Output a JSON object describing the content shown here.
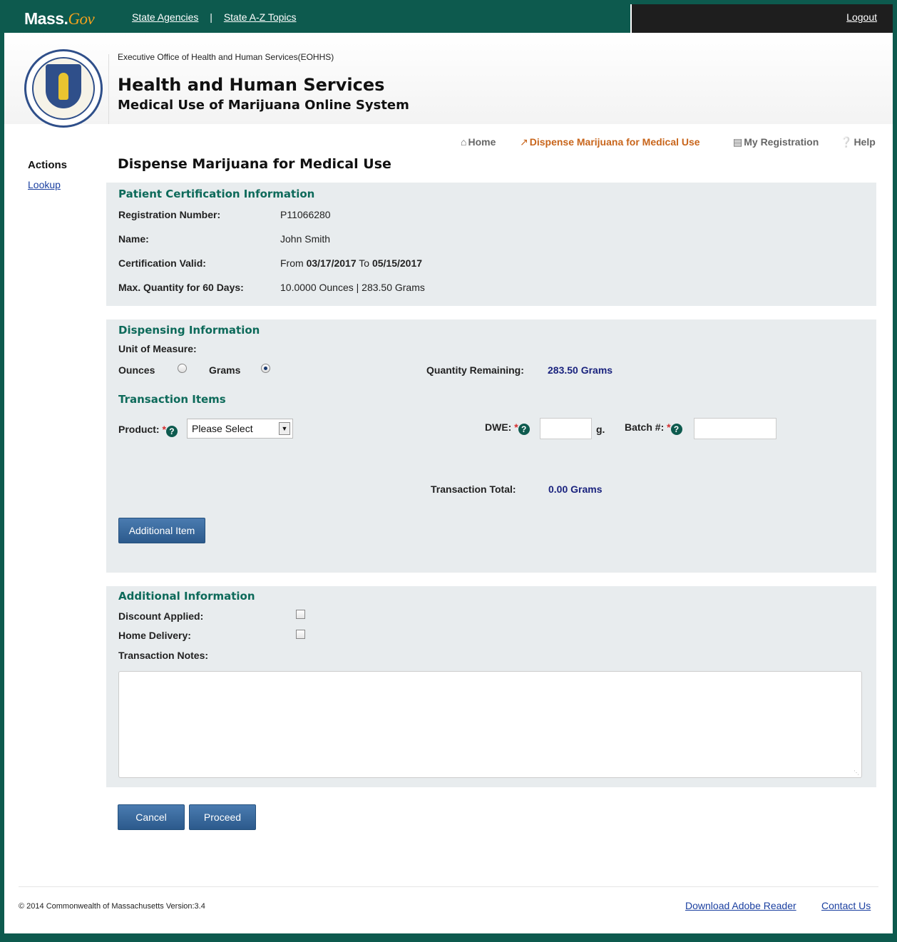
{
  "topbar": {
    "logo_mass": "Mass.",
    "logo_gov": "Gov",
    "links": [
      "State Agencies",
      "State A-Z Topics"
    ],
    "separator": "|",
    "logout": "Logout"
  },
  "header": {
    "agency": "Executive Office of Health and Human Services(EOHHS)",
    "title": "Health and Human Services",
    "subtitle": "Medical Use of Marijuana Online System"
  },
  "nav": {
    "home": "Home",
    "dispense": "Dispense Marijuana for Medical Use",
    "registration": "My Registration",
    "help": "Help"
  },
  "sidebar": {
    "title": "Actions",
    "lookup": "Lookup"
  },
  "page_title": "Dispense Marijuana for Medical Use",
  "patient": {
    "section_title": "Patient Certification Information",
    "reg_label": "Registration Number:",
    "reg_value": "P11066280",
    "name_label": "Name:",
    "name_value": "John Smith",
    "cert_label": "Certification Valid:",
    "cert_from_word": "From",
    "cert_from": "03/17/2017",
    "cert_to_word": "To",
    "cert_to": "05/15/2017",
    "max_label": "Max. Quantity for 60 Days:",
    "max_value": "10.0000 Ounces | 283.50 Grams"
  },
  "dispensing": {
    "section_title": "Dispensing Information",
    "uom_label": "Unit of Measure:",
    "ounces": "Ounces",
    "grams": "Grams",
    "selected_unit": "Grams",
    "qty_remaining_label": "Quantity Remaining:",
    "qty_remaining_value": "283.50 Grams",
    "transaction_items_title": "Transaction Items",
    "product_label": "Product:",
    "product_selected": "Please Select",
    "dwe_label": "DWE:",
    "dwe_unit": "g.",
    "batch_label": "Batch #:",
    "total_label": "Transaction Total:",
    "total_value": "0.00 Grams",
    "additional_item_button": "Additional Item"
  },
  "additional": {
    "section_title": "Additional Information",
    "discount_label": "Discount Applied:",
    "delivery_label": "Home Delivery:",
    "notes_label": "Transaction Notes:"
  },
  "buttons": {
    "cancel": "Cancel",
    "proceed": "Proceed"
  },
  "footer": {
    "copyright": "© 2014 Commonwealth of Massachusetts Version:3.4",
    "adobe": "Download Adobe Reader",
    "contact": "Contact Us"
  },
  "colors": {
    "brand_green": "#0d5a4e",
    "section_title": "#0d6a5a",
    "active_nav": "#c8651b",
    "value_blue": "#1a237e",
    "button_blue": "#2c5a8c"
  }
}
